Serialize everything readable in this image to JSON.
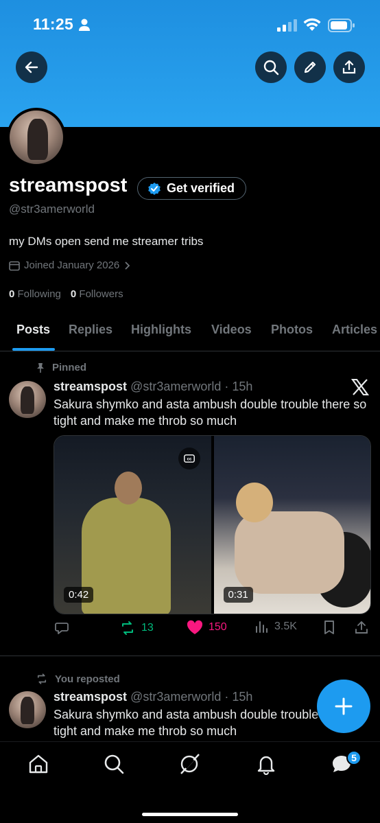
{
  "status_bar": {
    "time": "11:25"
  },
  "profile": {
    "display_name": "streamspost",
    "verify_label": "Get verified",
    "handle": "@str3amerworld",
    "bio": "my DMs open send me streamer tribs",
    "joined": "Joined January 2026",
    "following_count": "0",
    "following_label": "Following",
    "followers_count": "0",
    "followers_label": "Followers"
  },
  "tabs": [
    "Posts",
    "Replies",
    "Highlights",
    "Videos",
    "Photos",
    "Articles"
  ],
  "active_tab": "Posts",
  "posts": [
    {
      "context_label": "Pinned",
      "author": "streamspost",
      "meta": "@str3amerworld · 15h",
      "text": "Sakura shymko and asta ambush double trouble there so tight and make me throb so much",
      "videos": [
        {
          "duration": "0:42",
          "has_cc": true
        },
        {
          "duration": "0:31"
        }
      ],
      "reposts": "13",
      "likes": "150",
      "views": "3.5K"
    },
    {
      "context_label": "You reposted",
      "author": "streamspost",
      "meta": "@str3amerworld · 15h",
      "text": "Sakura shymko and asta ambush double trouble there so tight and make me throb so much"
    }
  ],
  "nav": {
    "messages_badge": "5"
  },
  "icons": {
    "back": "arrow-left-icon",
    "search": "search-icon",
    "edit": "pencil-icon",
    "share": "share-icon",
    "verified": "verified-badge-icon",
    "calendar": "calendar-icon",
    "pin": "pin-icon",
    "x_logo": "x-logo-icon",
    "reply": "reply-icon",
    "repost": "repost-icon",
    "like": "heart-icon",
    "views": "views-icon",
    "bookmark": "bookmark-icon",
    "compose": "plus-icon",
    "home": "home-icon",
    "explore": "search-icon",
    "grok": "grok-icon",
    "notifications": "bell-icon",
    "messages": "messages-icon"
  },
  "colors": {
    "accent": "#1d9bf0",
    "repost_active": "#00ba7c",
    "like_active": "#f91880",
    "muted": "#71767b"
  }
}
